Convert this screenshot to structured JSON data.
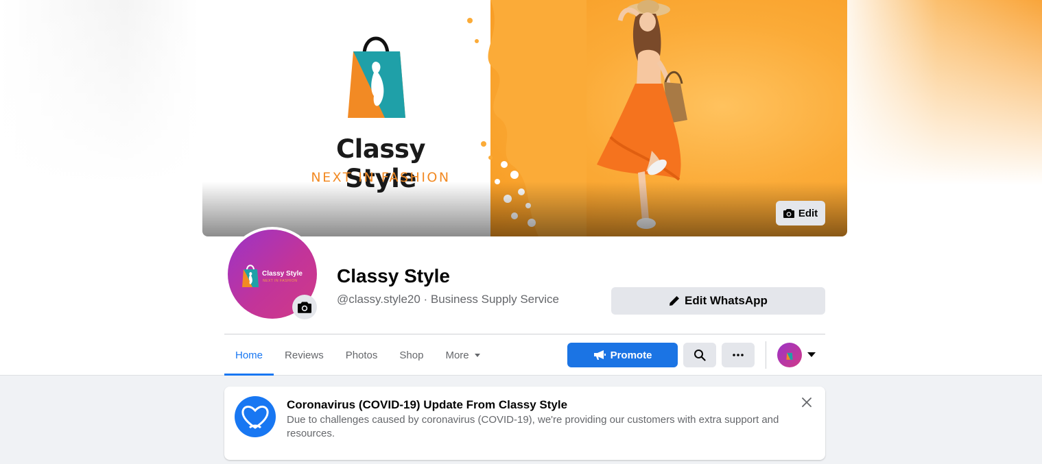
{
  "cover": {
    "brand_name": "Classy Style",
    "brand_tagline": "NEXT IN FASHION",
    "edit_label": "Edit",
    "edit_icon": "camera-icon"
  },
  "profile": {
    "avatar_brand_name": "Classy Style",
    "avatar_brand_tagline": "NEXT IN FASHION",
    "camera_icon": "camera-icon",
    "name": "Classy Style",
    "subtitle": "@classy.style20 · Business Supply Service"
  },
  "actions": {
    "edit_whatsapp_label": "Edit WhatsApp",
    "edit_whatsapp_icon": "pencil-icon",
    "promote_label": "Promote",
    "promote_icon": "megaphone-icon",
    "search_icon": "search-icon",
    "more_icon": "ellipsis-icon",
    "account_menu_icon": "caret-down-icon"
  },
  "tabs": [
    {
      "label": "Home",
      "active": true
    },
    {
      "label": "Reviews",
      "active": false
    },
    {
      "label": "Photos",
      "active": false
    },
    {
      "label": "Shop",
      "active": false
    },
    {
      "label": "More",
      "active": false,
      "dropdown": true
    }
  ],
  "covid_notice": {
    "icon": "heart-icon",
    "title": "Coronavirus (COVID-19) Update From Classy Style",
    "body": "Due to challenges caused by coronavirus (COVID-19), we're providing our customers with extra support and resources.",
    "close_icon": "close-icon"
  },
  "colors": {
    "accent_blue": "#1877f2",
    "brand_orange": "#f28a24",
    "brand_teal": "#1fa0a8",
    "avatar_purple": "#9b33c7",
    "avatar_pink": "#d13a86"
  }
}
